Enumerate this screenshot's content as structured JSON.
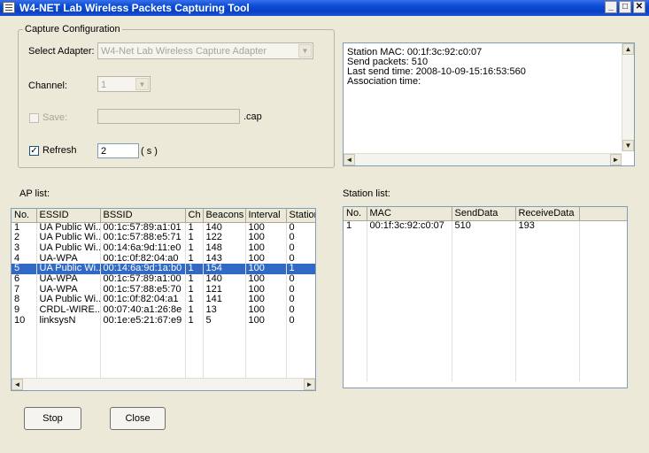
{
  "window": {
    "title": "W4-NET Lab Wireless Packets Capturing Tool",
    "min_glyph": "_",
    "max_glyph": "□",
    "close_glyph": "✕",
    "title_gradient": "#0a4fd8"
  },
  "capture_config": {
    "title": "Capture Configuration",
    "adapter_label": "Select Adapter:",
    "adapter_value": "W4-Net Lab Wireless Capture Adapter",
    "channel_label": "Channel:",
    "channel_value": "1",
    "save_label": "Save:",
    "save_checked": false,
    "save_value": "",
    "save_ext": ".cap",
    "refresh_label": "Refresh",
    "refresh_checked": true,
    "refresh_check_glyph": "✓",
    "refresh_value": "2",
    "refresh_unit": "( s )"
  },
  "station_info": {
    "lines": [
      "Station MAC: 00:1f:3c:92:c0:07",
      "Send packets: 510",
      "Last send time: 2008-10-09-15:16:53:560",
      "Association time:"
    ]
  },
  "ap_list": {
    "label": "AP list:",
    "columns": [
      "No.",
      "ESSID",
      "BSSID",
      "Ch",
      "Beacons",
      "Interval",
      "Station"
    ],
    "rows": [
      [
        "1",
        "UA Public Wi...",
        "00:1c:57:89:a1:01",
        "1",
        "140",
        "100",
        "0"
      ],
      [
        "2",
        "UA Public Wi...",
        "00:1c:57:88:e5:71",
        "1",
        "122",
        "100",
        "0"
      ],
      [
        "3",
        "UA Public Wi...",
        "00:14:6a:9d:11:e0",
        "1",
        "148",
        "100",
        "0"
      ],
      [
        "4",
        "UA-WPA",
        "00:1c:0f:82:04:a0",
        "1",
        "143",
        "100",
        "0"
      ],
      [
        "5",
        "UA Public Wi...",
        "00:14:6a:9d:1a:b0",
        "1",
        "154",
        "100",
        "1"
      ],
      [
        "6",
        "UA-WPA",
        "00:1c:57:89:a1:00",
        "1",
        "140",
        "100",
        "0"
      ],
      [
        "7",
        "UA-WPA",
        "00:1c:57:88:e5:70",
        "1",
        "121",
        "100",
        "0"
      ],
      [
        "8",
        "UA Public Wi...",
        "00:1c:0f:82:04:a1",
        "1",
        "141",
        "100",
        "0"
      ],
      [
        "9",
        "CRDL-WIRE...",
        "00:07:40:a1:26:8e",
        "1",
        "13",
        "100",
        "0"
      ],
      [
        "10",
        "linksysN",
        "00:1e:e5:21:67:e9",
        "1",
        "5",
        "100",
        "0"
      ]
    ],
    "selected_row": 4
  },
  "station_list": {
    "label": "Station list:",
    "columns": [
      "No.",
      "MAC",
      "SendData",
      "ReceiveData"
    ],
    "rows": [
      [
        "1",
        "00:1f:3c:92:c0:07",
        "510",
        "193"
      ]
    ]
  },
  "scroll": {
    "left": "◄",
    "right": "►",
    "up": "▲",
    "down": "▼"
  },
  "buttons": {
    "stop": "Stop",
    "close": "Close"
  }
}
